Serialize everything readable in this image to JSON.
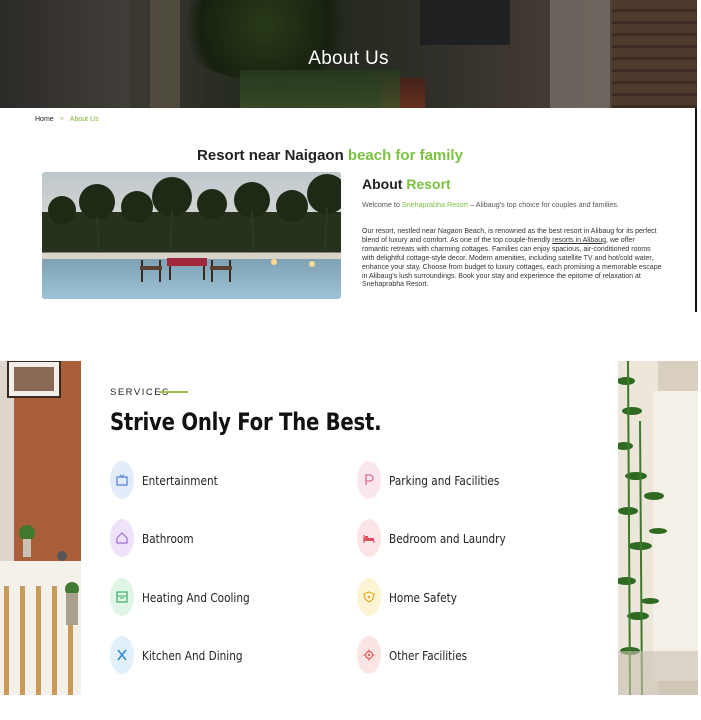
{
  "hero": {
    "title": "About Us"
  },
  "breadcrumb": {
    "home": "Home",
    "separator": ">",
    "current": "About Us"
  },
  "heading": {
    "prefix": "Resort near Naigaon ",
    "highlight": "beach for family"
  },
  "about": {
    "title_prefix": "About ",
    "title_highlight": "Resort",
    "welcome_prefix": "Welcome to ",
    "welcome_link": "Snehaprabha Resort",
    "welcome_suffix": " – Alibaug's top choice for couples and families.",
    "body_part1": "Our resort, nestled near Nagaon Beach, is renowned as the best resort in Alibaug for its perfect blend of luxury and comfort. As one of the top couple-friendly ",
    "body_link": "resorts in Alibaug",
    "body_part2": ", we offer romantic retreats with charming cottages. Families can enjoy spacious, air-conditioned rooms with delightful cottage-style decor. Modern amenities, including satellite TV and hot/cold water, enhance your stay. Choose from budget to luxury cottages, each promising a memorable escape in Alibaug's lush surroundings. Book your stay and experience the epitome of relaxation at Snehaprabha Resort."
  },
  "services": {
    "label": "SERVICES",
    "title": "Strive Only For The Best.",
    "items": [
      {
        "label": "Entertainment",
        "icon": "tv-icon",
        "glyph": "📺",
        "bg": "#e3ecfb",
        "color": "#4f7fd9"
      },
      {
        "label": "Parking and Facilities",
        "icon": "parking-icon",
        "glyph": "P",
        "bg": "#fbe6ee",
        "color": "#e0679a"
      },
      {
        "label": "Bathroom",
        "icon": "home-icon",
        "glyph": "⌂",
        "bg": "#efe3fb",
        "color": "#9b6fd8"
      },
      {
        "label": "Bedroom and Laundry",
        "icon": "bed-icon",
        "glyph": "🛏",
        "bg": "#fde4e6",
        "color": "#e0505c"
      },
      {
        "label": "Heating And Cooling",
        "icon": "heater-icon",
        "glyph": "▦",
        "bg": "#dff6e6",
        "color": "#3cae62"
      },
      {
        "label": "Home Safety",
        "icon": "shield-icon",
        "glyph": "⛉",
        "bg": "#fdf4d6",
        "color": "#e0aa22"
      },
      {
        "label": "Kitchen And Dining",
        "icon": "utensils-icon",
        "glyph": "✕",
        "bg": "#e1f0fb",
        "color": "#2f8fd8"
      },
      {
        "label": "Other Facilities",
        "icon": "gear-icon",
        "glyph": "⚙",
        "bg": "#fbe4e4",
        "color": "#e06060"
      }
    ]
  },
  "colors": {
    "accent": "#7cc242",
    "dark": "#222222"
  }
}
